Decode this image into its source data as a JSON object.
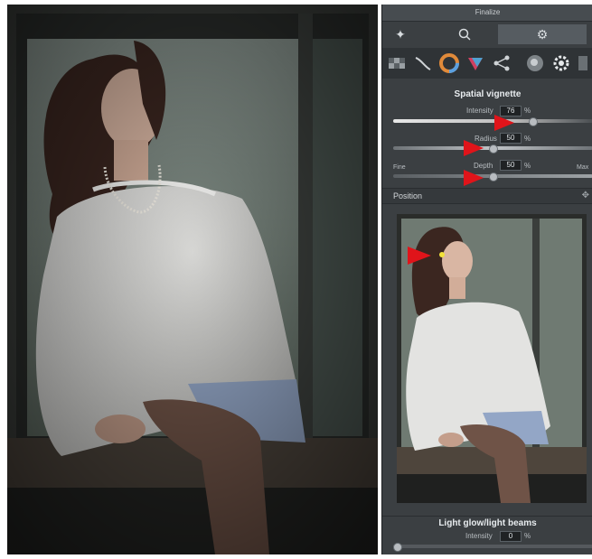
{
  "panel": {
    "title": "Finalize",
    "tabs": {
      "star_icon": "star-icon",
      "search_icon": "search-icon",
      "settings_icon": "gear-icon"
    },
    "tool_icons": [
      "checker-icon",
      "curve-icon",
      "color-wheel-icon",
      "rgb-icon",
      "share-nodes-icon",
      "search-icon",
      "cog-icon",
      "more-icon"
    ]
  },
  "vignette": {
    "heading": "Spatial vignette",
    "intensity_label": "Intensity",
    "intensity_value": "76",
    "radius_label": "Radius",
    "radius_value": "50",
    "depth_label": "Depth",
    "depth_value": "50",
    "percent": "%",
    "left_end": "Fine",
    "right_end": "Max"
  },
  "position": {
    "label": "Position"
  },
  "glow": {
    "heading": "Light glow/light beams",
    "intensity_label": "Intensity",
    "intensity_value": "0",
    "percent": "%"
  },
  "colors": {
    "accent_arrow": "#e0141a",
    "panel_bg": "#3b3f42"
  }
}
